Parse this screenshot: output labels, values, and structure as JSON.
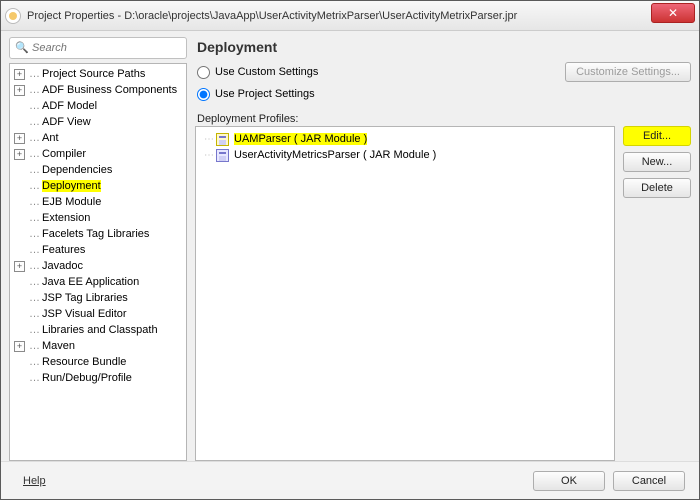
{
  "window": {
    "title": "Project Properties - D:\\oracle\\projects\\JavaApp\\UserActivityMetrixParser\\UserActivityMetrixParser.jpr"
  },
  "search": {
    "placeholder": "Search"
  },
  "tree": {
    "items": [
      {
        "label": "Project Source Paths",
        "expander": "+",
        "selected": false
      },
      {
        "label": "ADF Business Components",
        "expander": "+",
        "selected": false
      },
      {
        "label": "ADF Model",
        "expander": "",
        "selected": false
      },
      {
        "label": "ADF View",
        "expander": "",
        "selected": false
      },
      {
        "label": "Ant",
        "expander": "+",
        "selected": false
      },
      {
        "label": "Compiler",
        "expander": "+",
        "selected": false
      },
      {
        "label": "Dependencies",
        "expander": "",
        "selected": false
      },
      {
        "label": "Deployment",
        "expander": "",
        "selected": true
      },
      {
        "label": "EJB Module",
        "expander": "",
        "selected": false
      },
      {
        "label": "Extension",
        "expander": "",
        "selected": false
      },
      {
        "label": "Facelets Tag Libraries",
        "expander": "",
        "selected": false
      },
      {
        "label": "Features",
        "expander": "",
        "selected": false
      },
      {
        "label": "Javadoc",
        "expander": "+",
        "selected": false
      },
      {
        "label": "Java EE Application",
        "expander": "",
        "selected": false
      },
      {
        "label": "JSP Tag Libraries",
        "expander": "",
        "selected": false
      },
      {
        "label": "JSP Visual Editor",
        "expander": "",
        "selected": false
      },
      {
        "label": "Libraries and Classpath",
        "expander": "",
        "selected": false
      },
      {
        "label": "Maven",
        "expander": "+",
        "selected": false
      },
      {
        "label": "Resource Bundle",
        "expander": "",
        "selected": false
      },
      {
        "label": "Run/Debug/Profile",
        "expander": "",
        "selected": false
      }
    ]
  },
  "panel": {
    "heading": "Deployment",
    "radio_custom": "Use Custom Settings",
    "radio_project": "Use Project Settings",
    "settings_mode": "project",
    "customize_btn": "Customize Settings...",
    "profiles_label": "Deployment Profiles:",
    "profiles": [
      {
        "label": "UAMParser ( JAR Module )",
        "selected": true
      },
      {
        "label": "UserActivityMetricsParser ( JAR Module )",
        "selected": false
      }
    ],
    "edit_btn": "Edit...",
    "new_btn": "New...",
    "delete_btn": "Delete"
  },
  "footer": {
    "help": "Help",
    "ok": "OK",
    "cancel": "Cancel"
  }
}
